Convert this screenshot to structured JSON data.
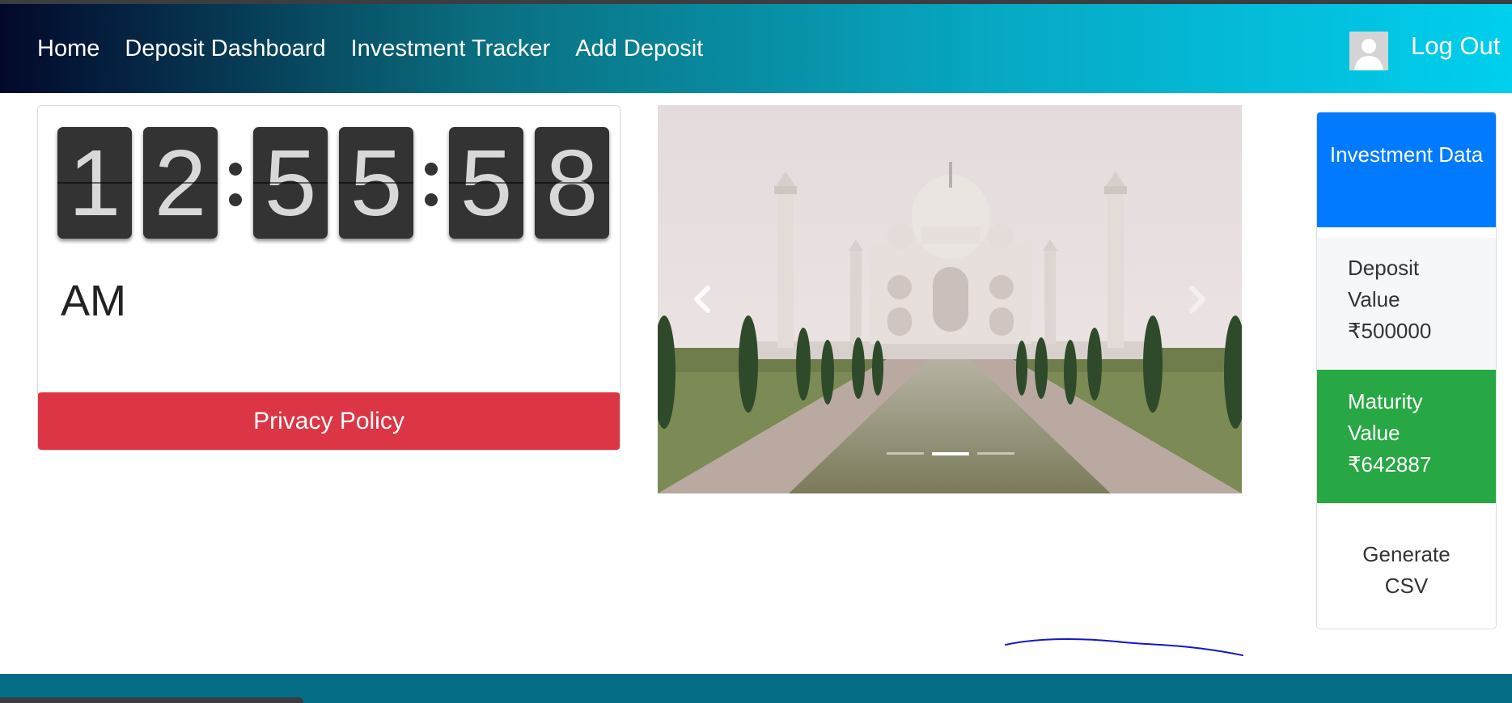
{
  "nav": {
    "links": [
      "Home",
      "Deposit Dashboard",
      "Investment Tracker",
      "Add Deposit"
    ],
    "logout": "Log Out"
  },
  "clock": {
    "digits": [
      "1",
      "2",
      "5",
      "5",
      "5",
      "8"
    ],
    "ampm": "AM",
    "privacy_label": "Privacy Policy"
  },
  "carousel": {
    "active_slide": 1,
    "slide_count": 3
  },
  "investment": {
    "header": "Investment Data",
    "deposit_label": "Deposit Value",
    "deposit_value": "₹500000",
    "maturity_label": "Maturity Value",
    "maturity_value": "₹642887",
    "csv_label": "Generate CSV"
  },
  "colors": {
    "danger": "#dc3545",
    "primary": "#007bff",
    "success": "#28a745",
    "footer": "#066d86"
  }
}
